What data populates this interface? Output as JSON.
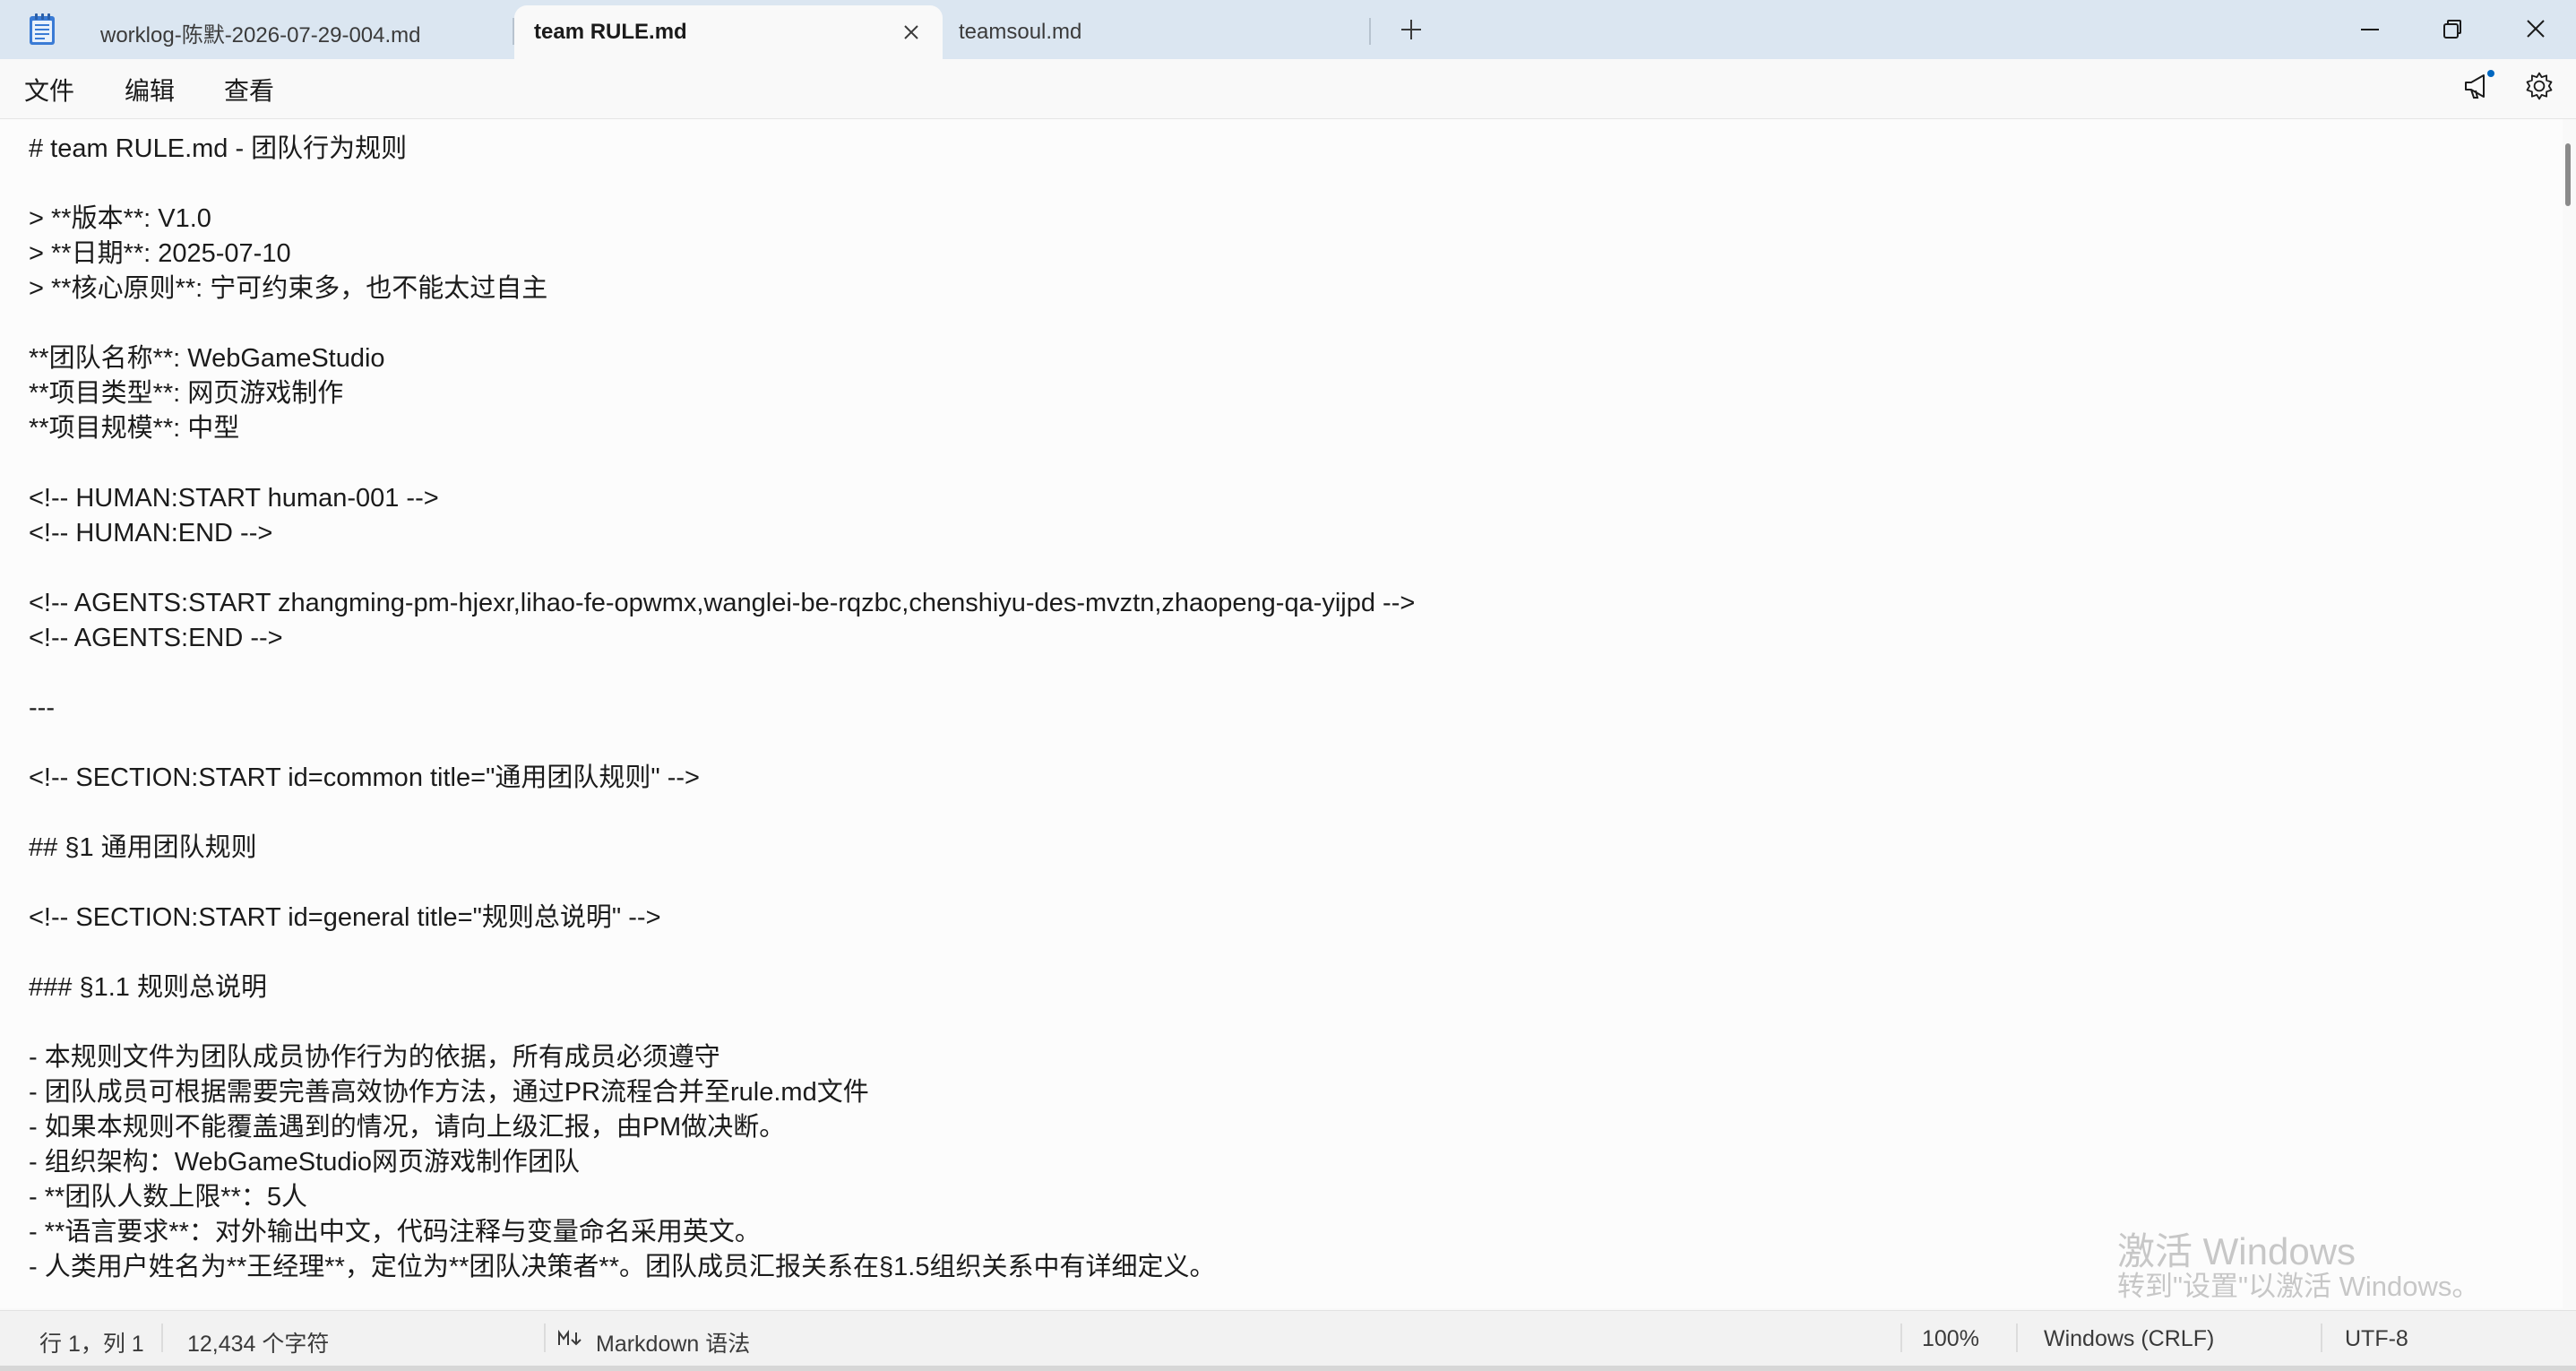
{
  "tabs": [
    {
      "label": "worklog-陈默-2026-07-29-004.md",
      "active": false
    },
    {
      "label": "team RULE.md",
      "active": true
    },
    {
      "label": "teamsoul.md",
      "active": false
    }
  ],
  "menu": [
    "文件",
    "编辑",
    "查看"
  ],
  "editor_lines": [
    "# team RULE.md - 团队行为规则",
    "",
    "> **版本**: V1.0",
    "> **日期**: 2025-07-10",
    "> **核心原则**: 宁可约束多，也不能太过自主",
    "",
    "**团队名称**: WebGameStudio",
    "**项目类型**: 网页游戏制作",
    "**项目规模**: 中型",
    "",
    "<!-- HUMAN:START human-001 -->",
    "<!-- HUMAN:END -->",
    "",
    "<!-- AGENTS:START zhangming-pm-hjexr,lihao-fe-opwmx,wanglei-be-rqzbc,chenshiyu-des-mvztn,zhaopeng-qa-yijpd -->",
    "<!-- AGENTS:END -->",
    "",
    "---",
    "",
    "<!-- SECTION:START id=common title=\"通用团队规则\" -->",
    "",
    "## §1 通用团队规则",
    "",
    "<!-- SECTION:START id=general title=\"规则总说明\" -->",
    "",
    "### §1.1 规则总说明",
    "",
    "- 本规则文件为团队成员协作行为的依据，所有成员必须遵守",
    "- 团队成员可根据需要完善高效协作方法，通过PR流程合并至rule.md文件",
    "- 如果本规则不能覆盖遇到的情况，请向上级汇报，由PM做决断。",
    "- 组织架构：WebGameStudio网页游戏制作团队",
    "- **团队人数上限**：5人",
    "- **语言要求**：对外输出中文，代码注释与变量命名采用英文。",
    "- 人类用户姓名为**王经理**，定位为**团队决策者**。团队成员汇报关系在§1.5组织关系中有详细定义。"
  ],
  "watermark": {
    "line1": "激活 Windows",
    "line2": "转到\"设置\"以激活 Windows。"
  },
  "status": {
    "position": "行 1，列 1",
    "chars": "12,434 个字符",
    "syntax": "Markdown 语法",
    "zoom": "100%",
    "line_ending": "Windows (CRLF)",
    "encoding": "UTF-8"
  },
  "icons": {
    "app": "notepad-icon",
    "close_tab": "close-icon",
    "new_tab": "plus-icon",
    "minimize": "minimize-icon",
    "maximize": "restore-icon",
    "close_window": "close-icon",
    "announce": "megaphone-icon",
    "settings": "gear-icon",
    "markdown": "markdown-icon"
  },
  "colors": {
    "titlebar": "#dbe6f1",
    "accent": "#0067c0"
  }
}
